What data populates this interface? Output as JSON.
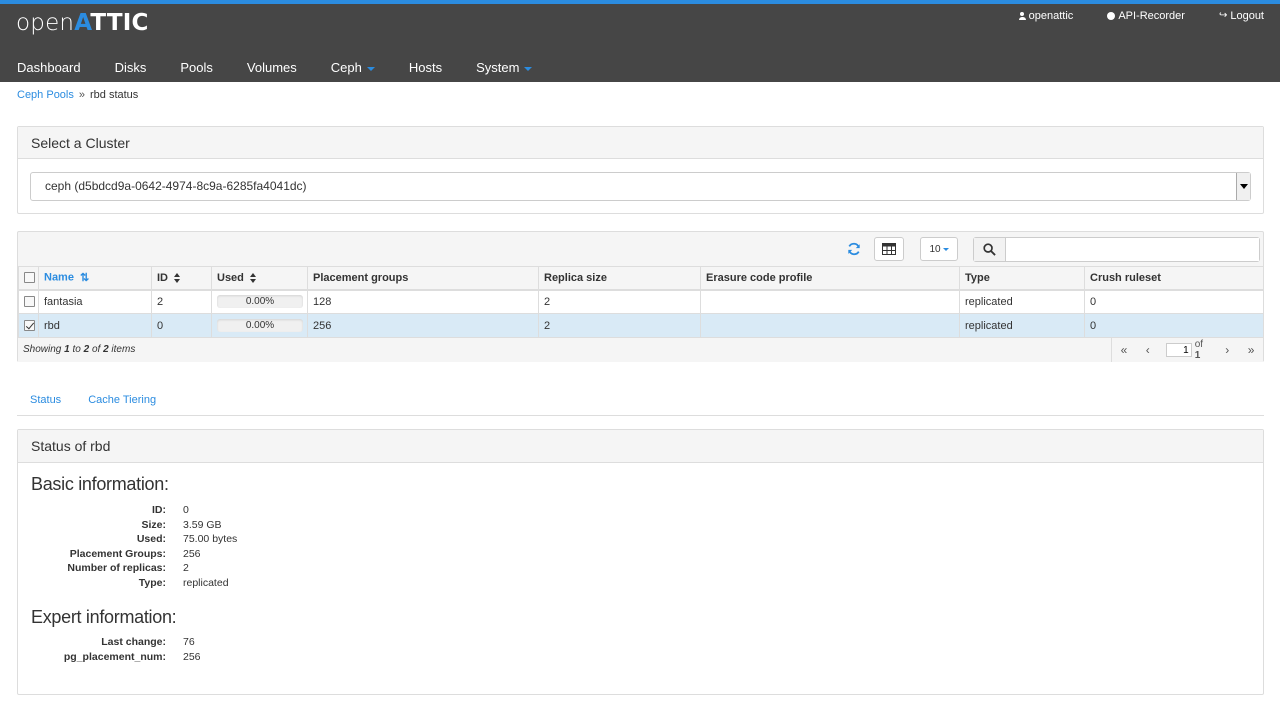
{
  "header": {
    "logo": {
      "light": "open",
      "strong": "TTIC",
      "accent": "A"
    },
    "user_links": [
      {
        "id": "user",
        "label": "openattic"
      },
      {
        "id": "api-recorder",
        "label": "API-Recorder"
      },
      {
        "id": "logout",
        "label": "Logout"
      }
    ],
    "nav": [
      {
        "label": "Dashboard",
        "dropdown": false
      },
      {
        "label": "Disks",
        "dropdown": false
      },
      {
        "label": "Pools",
        "dropdown": false
      },
      {
        "label": "Volumes",
        "dropdown": false
      },
      {
        "label": "Ceph",
        "dropdown": true
      },
      {
        "label": "Hosts",
        "dropdown": false
      },
      {
        "label": "System",
        "dropdown": true
      }
    ]
  },
  "breadcrumb": {
    "parent": "Ceph Pools",
    "current": "rbd status"
  },
  "cluster": {
    "title": "Select a Cluster",
    "selected": "ceph (d5bdcd9a-0642-4974-8c9a-6285fa4041dc)"
  },
  "grid": {
    "per_page": "10",
    "search_value": "",
    "columns": [
      "Name",
      "ID",
      "Used",
      "Placement groups",
      "Replica size",
      "Erasure code profile",
      "Type",
      "Crush ruleset"
    ],
    "rows": [
      {
        "name": "fantasia",
        "id": "2",
        "used": "0.00%",
        "pg": "128",
        "replica": "2",
        "ec_profile": "",
        "type": "replicated",
        "crush": "0",
        "checked": false
      },
      {
        "name": "rbd",
        "id": "0",
        "used": "0.00%",
        "pg": "256",
        "replica": "2",
        "ec_profile": "",
        "type": "replicated",
        "crush": "0",
        "checked": true
      }
    ],
    "footer": {
      "showing": "Showing",
      "from": "1",
      "to_word": "to",
      "to": "2",
      "of_word": "of",
      "total": "2",
      "items_word": "items"
    },
    "pager": {
      "page": "1",
      "of_label": "of",
      "pages": "1"
    }
  },
  "tabs": [
    "Status",
    "Cache Tiering"
  ],
  "status": {
    "title": "Status of rbd",
    "basic_title": "Basic information:",
    "basic": [
      {
        "label": "ID:",
        "value": "0"
      },
      {
        "label": "Size:",
        "value": "3.59 GB"
      },
      {
        "label": "Used:",
        "value": "75.00 bytes"
      },
      {
        "label": "Placement Groups:",
        "value": "256"
      },
      {
        "label": "Number of replicas:",
        "value": "2"
      },
      {
        "label": "Type:",
        "value": "replicated"
      }
    ],
    "expert_title": "Expert information:",
    "expert": [
      {
        "label": "Last change:",
        "value": "76"
      },
      {
        "label": "pg_placement_num:",
        "value": "256"
      }
    ]
  },
  "colors": {
    "accent": "#2b8ce0",
    "header_bg": "#464646",
    "selected_row": "#d9eaf6"
  },
  "icons": {
    "user": "user-icon",
    "api": "circle-icon",
    "logout": "sign-out-icon",
    "refresh": "refresh-icon",
    "columns": "table-icon",
    "search": "search-icon"
  }
}
